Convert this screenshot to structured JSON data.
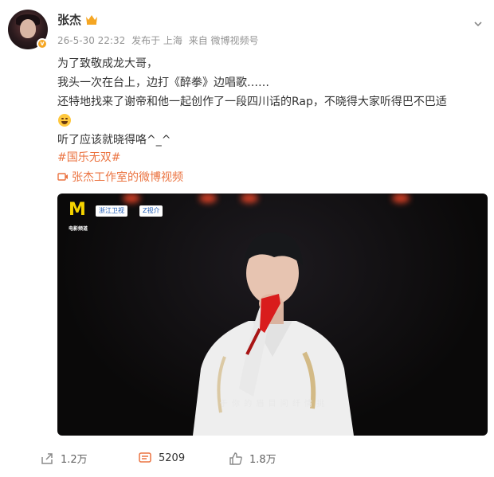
{
  "post": {
    "author": "张杰",
    "timestamp": "26-5-30 22:32",
    "location": "发布于 上海",
    "source": "来自 微博视频号",
    "content_lines": [
      "为了致敬成龙大哥，",
      "我头一次在台上，边打《醉拳》边唱歌……",
      "还特地找来了谢帝和他一起创作了一段四川话的Rap，不晓得大家听得巴不巴适",
      "",
      "听了应该就晓得咯^_^"
    ],
    "hashtag": "#国乐无双#",
    "video_link": "张杰工作室的微博视频"
  },
  "video": {
    "logo_text": "M",
    "logo_caption": "电影频道",
    "channel_badges": [
      "浙江卫视",
      "Z视介"
    ],
    "subtitle": "于 你 的 眉 目 间 纤 情 挑"
  },
  "actions": {
    "repost_count": "1.2万",
    "comment_count": "5209",
    "like_count": "1.8万"
  },
  "colors": {
    "accent": "#eb7340",
    "meta": "#939393"
  }
}
